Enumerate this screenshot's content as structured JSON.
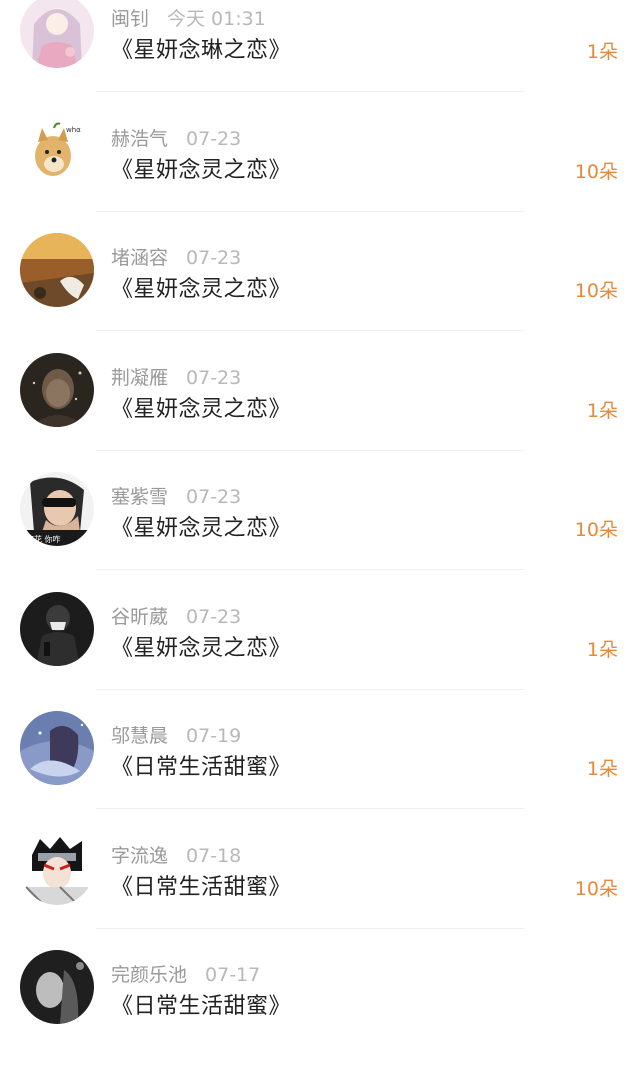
{
  "gift_unit": "朵",
  "accent_color": "#e7893a",
  "items": [
    {
      "name": "闽钊",
      "date": "今天 01:31",
      "work": "《星妍念琳之恋》",
      "count": "1",
      "avatar": "anime-girl-avatar"
    },
    {
      "name": "赫浩气",
      "date": "07-23",
      "work": "《星妍念灵之恋》",
      "count": "10",
      "avatar": "doge-avatar"
    },
    {
      "name": "堵涵容",
      "date": "07-23",
      "work": "《星妍念灵之恋》",
      "count": "10",
      "avatar": "autumn-road-avatar"
    },
    {
      "name": "荆凝雁",
      "date": "07-23",
      "work": "《星妍念灵之恋》",
      "count": "1",
      "avatar": "dark-portrait-avatar"
    },
    {
      "name": "塞紫雪",
      "date": "07-23",
      "work": "《星妍念灵之恋》",
      "count": "10",
      "avatar": "sunglasses-man-avatar"
    },
    {
      "name": "谷昕葳",
      "date": "07-23",
      "work": "《星妍念灵之恋》",
      "count": "1",
      "avatar": "masked-person-avatar"
    },
    {
      "name": "邬慧晨",
      "date": "07-19",
      "work": "《日常生活甜蜜》",
      "count": "1",
      "avatar": "fantasy-girl-avatar"
    },
    {
      "name": "字流逸",
      "date": "07-18",
      "work": "《日常生活甜蜜》",
      "count": "10",
      "avatar": "ninja-avatar"
    },
    {
      "name": "完颜乐池",
      "date": "07-17",
      "work": "《日常生活甜蜜》",
      "count": "",
      "avatar": "bw-photo-avatar"
    }
  ]
}
